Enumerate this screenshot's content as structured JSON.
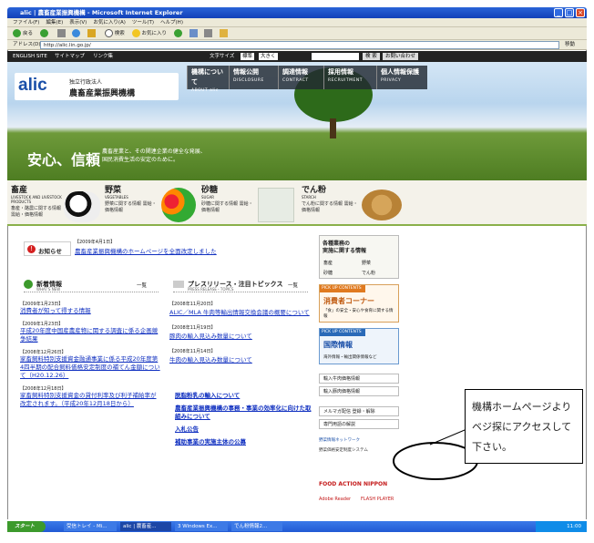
{
  "window": {
    "title": "alic | 農畜産業振興機構 - Microsoft Internet Explorer",
    "minimize": "_",
    "maximize": "□",
    "close": "×"
  },
  "menu": [
    "ファイル(F)",
    "編集(E)",
    "表示(V)",
    "お気に入り(A)",
    "ツール(T)",
    "ヘルプ(H)"
  ],
  "toolbar": {
    "back": "戻る",
    "search": "検索",
    "favorites": "お気に入り"
  },
  "address": {
    "label": "アドレス(D)",
    "url": "http://alic.lin.go.jp/",
    "go": "移動",
    "links": "リンク"
  },
  "util": {
    "english": "ENGLISH SITE",
    "sitemap": "サイトマップ",
    "links": "リンク集",
    "textsize_label": "文字サイズ",
    "std": "標準",
    "large": "大きく",
    "search_btn": "検 索",
    "contact": "お問い合わせ"
  },
  "logo": {
    "mark": "alic",
    "sub": "独立行政法人",
    "name": "農畜産業振興機構"
  },
  "nav": [
    {
      "jp": "機構について",
      "en": "ABOUT alic"
    },
    {
      "jp": "情報公開",
      "en": "DISCLOSURE"
    },
    {
      "jp": "調達情報",
      "en": "CONTRACT"
    },
    {
      "jp": "採用情報",
      "en": "RECRUITMENT"
    },
    {
      "jp": "個人情報保護",
      "en": "PRIVACY"
    }
  ],
  "hero": {
    "main": "安心、信頼",
    "sub1": "農畜産業と、その関連企業の健全な発展、",
    "sub2": "国民消費生活の安定のために。"
  },
  "categories": [
    {
      "name": "畜産",
      "en": "LIVESTOCK AND LIVESTOCK PRODUCTS",
      "desc": "畜産・酪農に関する情報 需給・価格情報"
    },
    {
      "name": "野菜",
      "en": "VEGETABLES",
      "desc": "野菜に関する情報 需給・価格情報"
    },
    {
      "name": "砂糖",
      "en": "SUGAR",
      "desc": "砂糖に関する情報 需給・価格情報"
    },
    {
      "name": "でん粉",
      "en": "STARCH",
      "desc": "でん粉に関する情報 需給・価格情報"
    }
  ],
  "notice": {
    "label": "お知らせ",
    "date": "【2009年4月1日】",
    "text": "農畜産業振興機構のホームページを全面改定しました"
  },
  "news": {
    "title": "新着情報",
    "en": "WHAT'S NEW",
    "list_btn": "一覧",
    "items": [
      {
        "date": "【2009年1月23日】",
        "text": "消費者が知って得する情報"
      },
      {
        "date": "【2009年1月23日】",
        "text": "平成20年度中国産農産物に関する調査に係る企画競争結果"
      },
      {
        "date": "【2008年12月26日】",
        "text": "家畜飼料特別支援資金融通事業に係る平成20年度第4四半期の配合飼料価格安定制度の補てん金額について（H20.12.26）"
      },
      {
        "date": "【2008年12月18日】",
        "text": "家畜飼料特別支援資金の貸付利率及び利子補給率が改定されます。（平成20年12月18日から）"
      }
    ]
  },
  "press": {
    "title": "プレスリリース・注目トピックス",
    "en": "PRESS RELEASE・TOPICS",
    "list_btn": "一覧",
    "items": [
      {
        "date": "【2008年11月20日】",
        "text": "ALIC／MLA 牛肉等輸出情報交換会議の概要について"
      },
      {
        "date": "【2008年11月19日】",
        "text": "豚肉の輸入見込み数量について"
      },
      {
        "date": "【2008年11月14日】",
        "text": "牛肉の輸入見込み数量について"
      }
    ],
    "links": [
      "脱脂粉乳の輸入について",
      "農畜産業振興機構の事務・事業の効率化に向けた取組みについて",
      "入札公告",
      "補助事業の実施主体の公募"
    ]
  },
  "sidebar": {
    "jobs_title": "各種業務の",
    "jobs_sub": "実施に関する情報",
    "job_links": [
      "畜産",
      "野菜",
      "砂糖",
      "でん粉"
    ],
    "consumer": "消費者コーナー",
    "consumer_desc": "「食」の安全・安心や食育に関する情報",
    "pickup": "PICK UP CONTENTS",
    "intl": "国際情報",
    "intl_desc": "海外情報・輸出関係情報など",
    "beef": "輸入牛肉価格情報",
    "pork": "輸入豚肉価格情報",
    "mail": "メルマガ配信 登録・解除",
    "glossary": "専門用語の解説",
    "network": "野菜情報ネットワーク",
    "vege_sys": "野菜価格安定制度システム",
    "food": "FOOD ACTION NIPPON",
    "reader": "Adobe Reader",
    "flash": "FLASH PLAYER"
  },
  "callout": {
    "text": "機構ホームページよりベジ探にアクセスして下さい。"
  },
  "taskbar": {
    "start": "スタート",
    "tasks": [
      "受信トレイ - Mi...",
      "alic | 農畜産...",
      "3 Windows Ex...",
      "でん粉情報2..."
    ],
    "time": "11:00"
  },
  "colors": {
    "titlebar": "#1f54c8",
    "taskbar": "#245edc",
    "accent_green": "#8ab04a",
    "red": "#d52020"
  }
}
